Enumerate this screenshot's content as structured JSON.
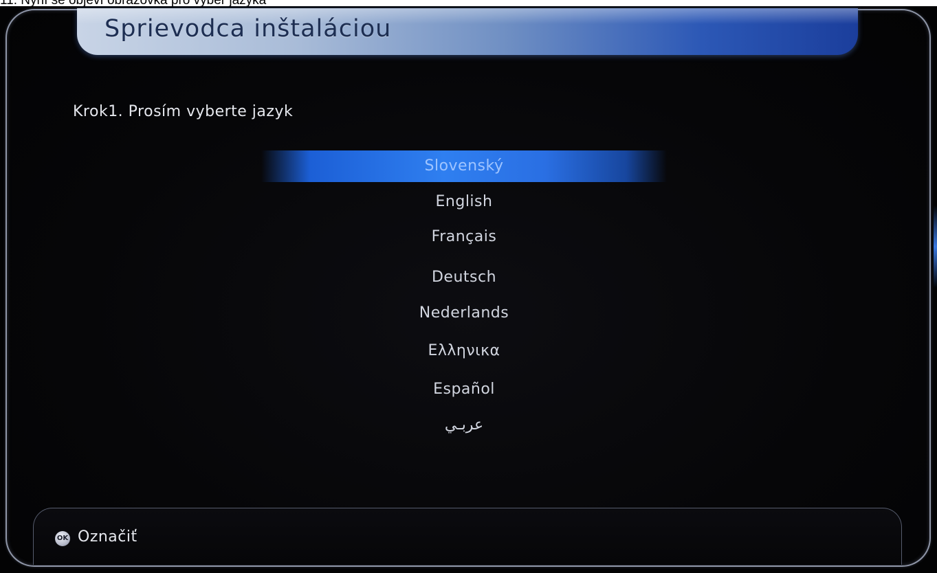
{
  "caption": "11. Nyní se objeví obrazovka pro výběr jazyka",
  "screen": {
    "title": "Sprievodca inštaláciou",
    "step": "Krok1. Prosím vyberte jazyk",
    "languages": [
      {
        "label": "Slovenský",
        "selected": true
      },
      {
        "label": "English",
        "selected": false
      },
      {
        "label": "Français",
        "selected": false
      },
      {
        "label": "Deutsch",
        "selected": false
      },
      {
        "label": "Nederlands",
        "selected": false
      },
      {
        "label": "Ελληνικα",
        "selected": false
      },
      {
        "label": "Español",
        "selected": false
      },
      {
        "label": "عربـي",
        "selected": false
      }
    ],
    "footer": {
      "ok_icon_text": "OK",
      "ok_icon": "ok-button-icon",
      "action_label": "Označiť"
    }
  },
  "colors": {
    "background": "#030304",
    "title_bar_start": "#c8d4e6",
    "title_bar_end": "#1b3e9c",
    "selection": "#2f7ff0",
    "text": "#d2d6e0"
  }
}
